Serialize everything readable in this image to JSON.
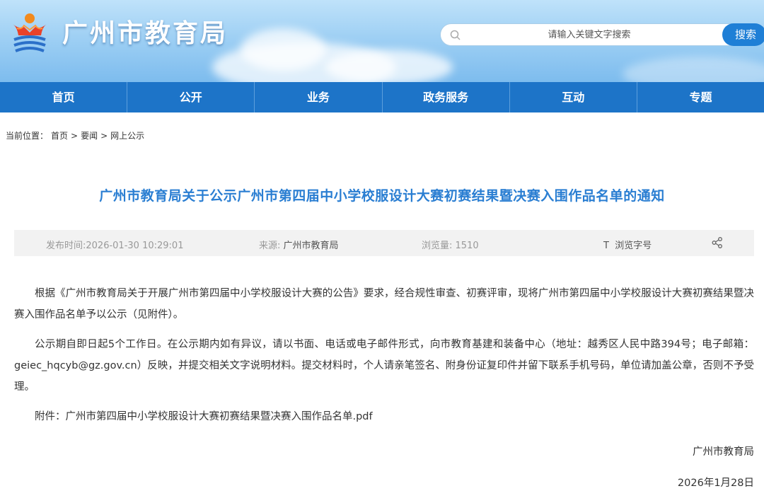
{
  "header": {
    "site_title": "广州市教育局",
    "search_placeholder": "请输入关键文字搜索",
    "search_button": "搜索"
  },
  "nav": {
    "items": [
      {
        "label": "首页"
      },
      {
        "label": "公开"
      },
      {
        "label": "业务"
      },
      {
        "label": "政务服务"
      },
      {
        "label": "互动"
      },
      {
        "label": "专题"
      }
    ]
  },
  "breadcrumb": {
    "prefix": "当前位置：",
    "items": [
      "首页",
      "要闻",
      "网上公示"
    ],
    "separator": ">"
  },
  "article": {
    "title": "广州市教育局关于公示广州市第四届中小学校服设计大赛初赛结果暨决赛入围作品名单的通知",
    "meta": {
      "publish_label": "发布时间:",
      "publish_time": "2026-01-30 10:29:01",
      "source_label": "来源:",
      "source": "广州市教育局",
      "views_label": "浏览量:",
      "views": "1510",
      "font_icon": "T",
      "font_label": "浏览字号",
      "share_icon": "share-icon"
    },
    "paragraphs": [
      "根据《广州市教育局关于开展广州市第四届中小学校服设计大赛的公告》要求，经合规性审查、初赛评审，现将广州市第四届中小学校服设计大赛初赛结果暨决赛入围作品名单予以公示（见附件）。",
      "公示期自即日起5个工作日。在公示期内如有异议，请以书面、电话或电子邮件形式，向市教育基建和装备中心（地址：越秀区人民中路394号；电子邮箱：geiec_hqcyb@gz.gov.cn）反映，并提交相关文字说明材料。提交材料时，个人请亲笔签名、附身份证复印件并留下联系手机号码，单位请加盖公章，否则不予受理。"
    ],
    "attachment_label": "附件：",
    "attachment_name": "广州市第四届中小学校服设计大赛初赛结果暨决赛入围作品名单.pdf",
    "signature": "广州市教育局",
    "date": "2026年1月28日"
  },
  "colors": {
    "nav_bg": "#1d74c8",
    "title": "#2a7ed2",
    "search_button": "#1f7fd6"
  }
}
